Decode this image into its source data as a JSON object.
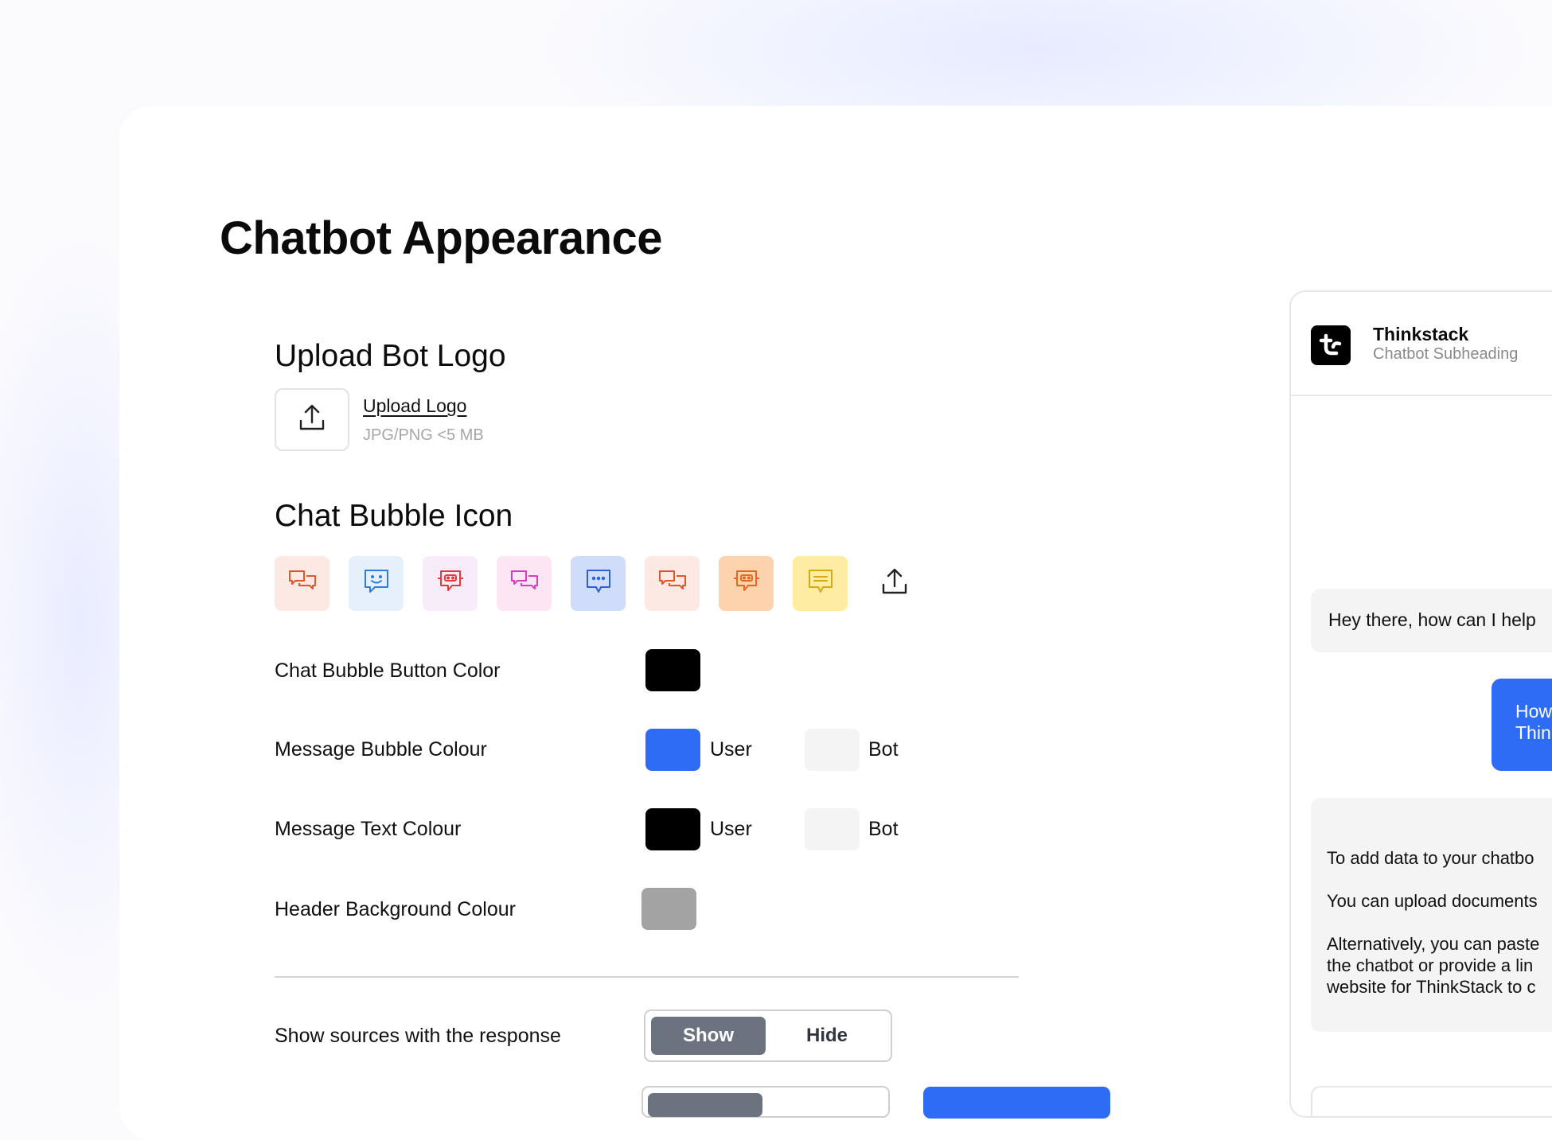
{
  "page": {
    "title": "Chatbot Appearance"
  },
  "upload_logo": {
    "section_title": "Upload Bot Logo",
    "link_label": "Upload Logo",
    "hint": "JPG/PNG <5 MB",
    "icon": "upload-icon"
  },
  "chat_bubble_icon": {
    "section_title": "Chat Bubble Icon",
    "options": [
      {
        "icon": "chat-bubbles-icon",
        "bg": "#fde9e4",
        "color": "#e0572f"
      },
      {
        "icon": "smiley-chat-icon",
        "bg": "#e6f0fd",
        "color": "#2d7ae0"
      },
      {
        "icon": "robot-chat-icon",
        "bg": "#f9ecfa",
        "color": "#e03a3a"
      },
      {
        "icon": "chat-bubbles-icon",
        "bg": "#fde6f3",
        "color": "#d83ac0"
      },
      {
        "icon": "dots-chat-icon",
        "bg": "#cfdcfa",
        "color": "#2f5fd6"
      },
      {
        "icon": "chat-bubbles-icon",
        "bg": "#fde9e4",
        "color": "#e0572f"
      },
      {
        "icon": "robot-chat-icon",
        "bg": "#fcd3ad",
        "color": "#e06a1f"
      },
      {
        "icon": "lines-chat-icon",
        "bg": "#fdeca1",
        "color": "#d9a70f"
      }
    ],
    "upload_icon": "upload-icon"
  },
  "colors": {
    "chat_bubble_button": {
      "label": "Chat Bubble Button Color",
      "value": "#000000"
    },
    "message_bubble": {
      "label": "Message  Bubble Colour",
      "user_label": "User",
      "user_value": "#2e6cf6",
      "bot_label": "Bot",
      "bot_value": "#f4f4f4"
    },
    "message_text": {
      "label": "Message  Text  Colour",
      "user_label": "User",
      "user_value": "#000000",
      "bot_label": "Bot",
      "bot_value": "#f4f4f4"
    },
    "header_background": {
      "label": "Header Background Colour",
      "value": "#a3a3a3"
    }
  },
  "show_sources": {
    "label": "Show sources with the response",
    "options": [
      "Show",
      "Hide"
    ],
    "selected": "Show"
  },
  "preview": {
    "bot_name": "Thinkstack",
    "bot_subheading": "Chatbot Subheading",
    "logo_icon": "thinkstack-logo-icon",
    "messages": {
      "bot_greeting": "Hey there, how can I help",
      "user_line1": "How",
      "user_line2": "Thin",
      "bot_reply_p1": "To add data to your chatbo",
      "bot_reply_p2": "You can upload documents",
      "bot_reply_p3_line1": "Alternatively, you can paste",
      "bot_reply_p3_line2": "the chatbot or provide a lin",
      "bot_reply_p3_line3": "website for ThinkStack to c"
    }
  }
}
